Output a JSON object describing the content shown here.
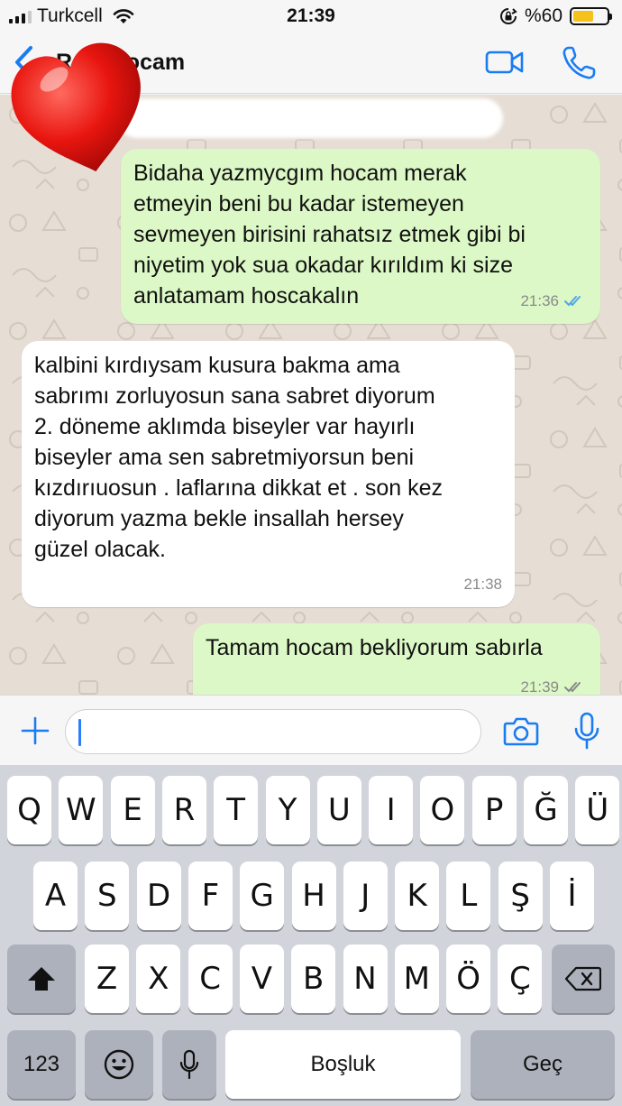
{
  "status_bar": {
    "carrier": "Turkcell",
    "time": "21:39",
    "battery_percent": "%60",
    "battery_level": 0.6,
    "battery_color": "#f4c21a"
  },
  "nav": {
    "contact_name": "Re... Hocam",
    "accent_color": "#1a7cf2"
  },
  "chat": {
    "messages": [
      {
        "direction": "outgoing",
        "text": "Bidaha yazmycgım hocam merak\netmeyin beni bu kadar istemeyen\nsevmeyen birisini rahatsız etmek gibi bi\nniyetim yok sua okadar kırıldım ki size\nanlatamam hoscakalın",
        "time": "21:36",
        "status": "read"
      },
      {
        "direction": "incoming",
        "text": "kalbini kırdıysam kusura bakma ama\nsabrımı zorluyosun sana sabret diyorum\n2. döneme aklımda biseyler var hayırlı\nbiseyler ama sen sabretmiyorsun beni\nkızdırıuosun . laflarına dikkat et . son kez\ndiyorum yazma bekle insallah hersey\ngüzel olacak.",
        "time": "21:38"
      },
      {
        "direction": "outgoing",
        "text": "Tamam hocam bekliyorum sabırla",
        "time": "21:39",
        "status": "sent"
      }
    ],
    "outgoing_bubble_color": "#dcf8c6",
    "incoming_bubble_color": "#ffffff",
    "background_color": "#e6ddd4"
  },
  "composer": {
    "input_value": ""
  },
  "keyboard": {
    "row1": [
      "Q",
      "W",
      "E",
      "R",
      "T",
      "Y",
      "U",
      "I",
      "O",
      "P",
      "Ğ",
      "Ü"
    ],
    "row2": [
      "A",
      "S",
      "D",
      "F",
      "G",
      "H",
      "J",
      "K",
      "L",
      "Ş",
      "İ"
    ],
    "row3": [
      "Z",
      "X",
      "C",
      "V",
      "B",
      "N",
      "M",
      "Ö",
      "Ç"
    ],
    "numbers_key": "123",
    "space_key": "Boşluk",
    "return_key": "Geç"
  },
  "icons": [
    "back-chevron-icon",
    "video-call-icon",
    "phone-call-icon",
    "heart-sticker-icon",
    "plus-icon",
    "camera-icon",
    "microphone-icon",
    "shift-icon",
    "delete-icon",
    "emoji-icon",
    "dictation-icon",
    "read-ticks-icon",
    "signal-icon",
    "wifi-icon",
    "rotation-lock-icon",
    "battery-icon"
  ]
}
